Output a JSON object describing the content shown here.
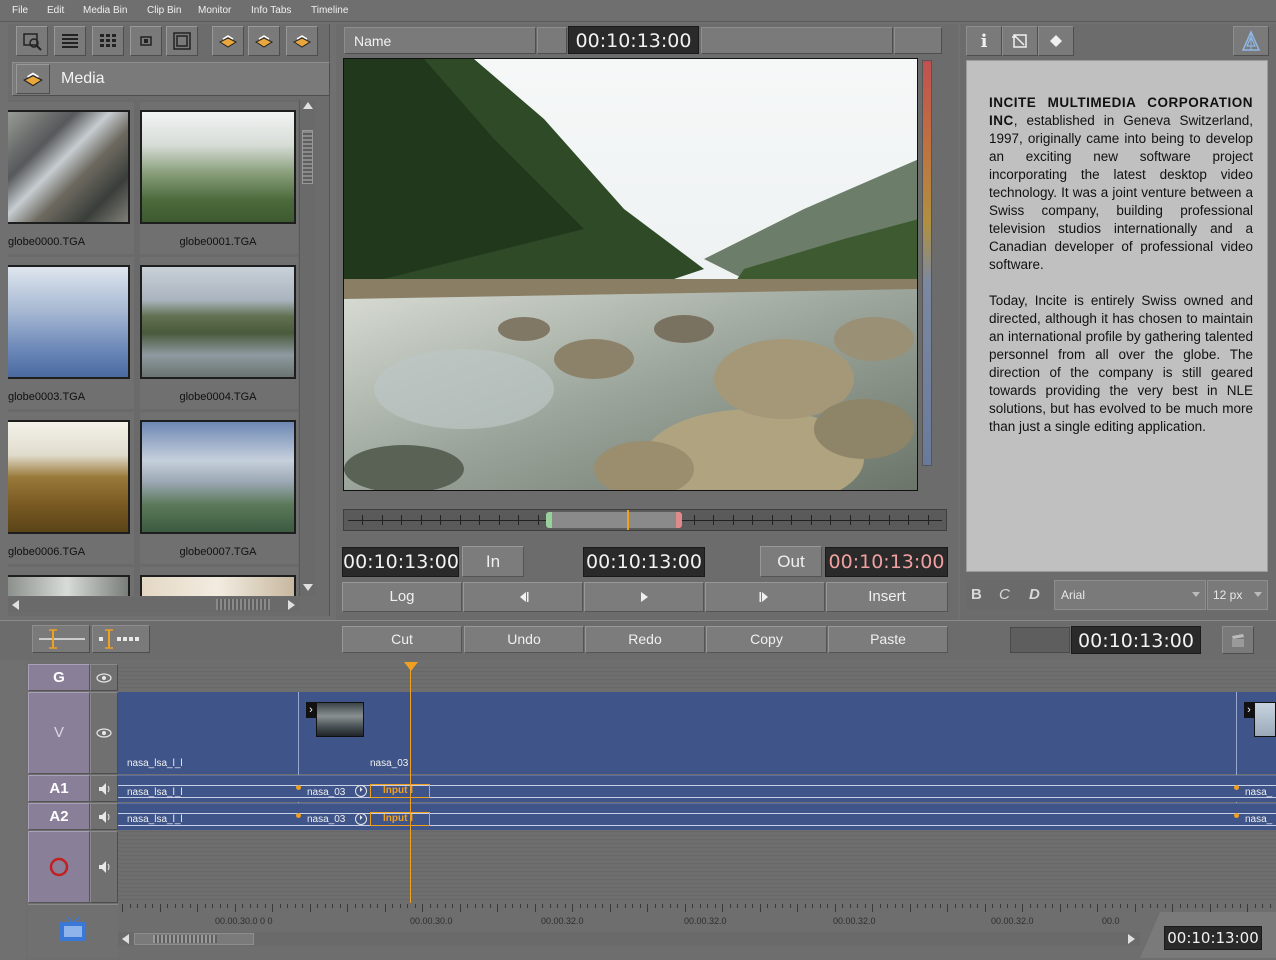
{
  "menubar": [
    "File",
    "Edit",
    "Media Bin",
    "Clip Bin",
    "Monitor",
    "Info Tabs",
    "Timeline"
  ],
  "media_bin": {
    "title": "Media",
    "items": [
      {
        "name": "globe0000.TGA"
      },
      {
        "name": "globe0001.TGA"
      },
      {
        "name": "globe0003.TGA"
      },
      {
        "name": "globe0004.TGA"
      },
      {
        "name": "globe0006.TGA"
      },
      {
        "name": "globe0007.TGA"
      }
    ]
  },
  "monitor": {
    "name_label": "Name",
    "top_timecode": "00:10:13:00",
    "in_timecode": "00:10:13:00",
    "in_label": "In",
    "current_timecode": "00:10:13:00",
    "out_label": "Out",
    "out_timecode": "00:10:13:00",
    "log_label": "Log",
    "insert_label": "Insert"
  },
  "info": {
    "company": "INCITE MULTIMEDIA CORPORATION INC",
    "para1_rest": ", established in Geneva Switzerland, 1997, originally came into being to develop an exciting new software project incorporating the latest desktop video technology. It was a joint venture between a Swiss company, building professional television studios internationally and a Canadian developer of professional video software.",
    "para2": "Today, Incite is entirely Swiss owned and directed, although it has chosen to maintain an international profile by gathering talented personnel from all over the globe. The direction of the company is still geared towards providing the very best in NLE solutions, but has evolved to be much more than just a single editing application.",
    "format_b": "B",
    "format_c": "C",
    "format_d": "D",
    "font_name": "Arial",
    "font_size": "12 px"
  },
  "edit_toolbar": {
    "cut": "Cut",
    "undo": "Undo",
    "redo": "Redo",
    "copy": "Copy",
    "paste": "Paste",
    "timecode": "00:10:13:00"
  },
  "timeline": {
    "tracks": [
      "G",
      "V",
      "A1",
      "A2"
    ],
    "clip1_name": "nasa_lsa_l_l",
    "clip2_name": "nasa_03",
    "clip3_name": "nasa_",
    "input_label": "Input I",
    "ruler_labels": [
      "00.00.30.0 0 0",
      "00.00.30.0",
      "00.00.32.0",
      "00.00.32.0",
      "00.00.32.0",
      "00.00.32.0",
      "00.0"
    ],
    "bottom_timecode": "00:10:13:00"
  },
  "colors": {
    "accent_orange": "#f0a020",
    "track_head": "#8a7f98",
    "timeline_video": "#3f5488",
    "record_red": "#c02020"
  }
}
